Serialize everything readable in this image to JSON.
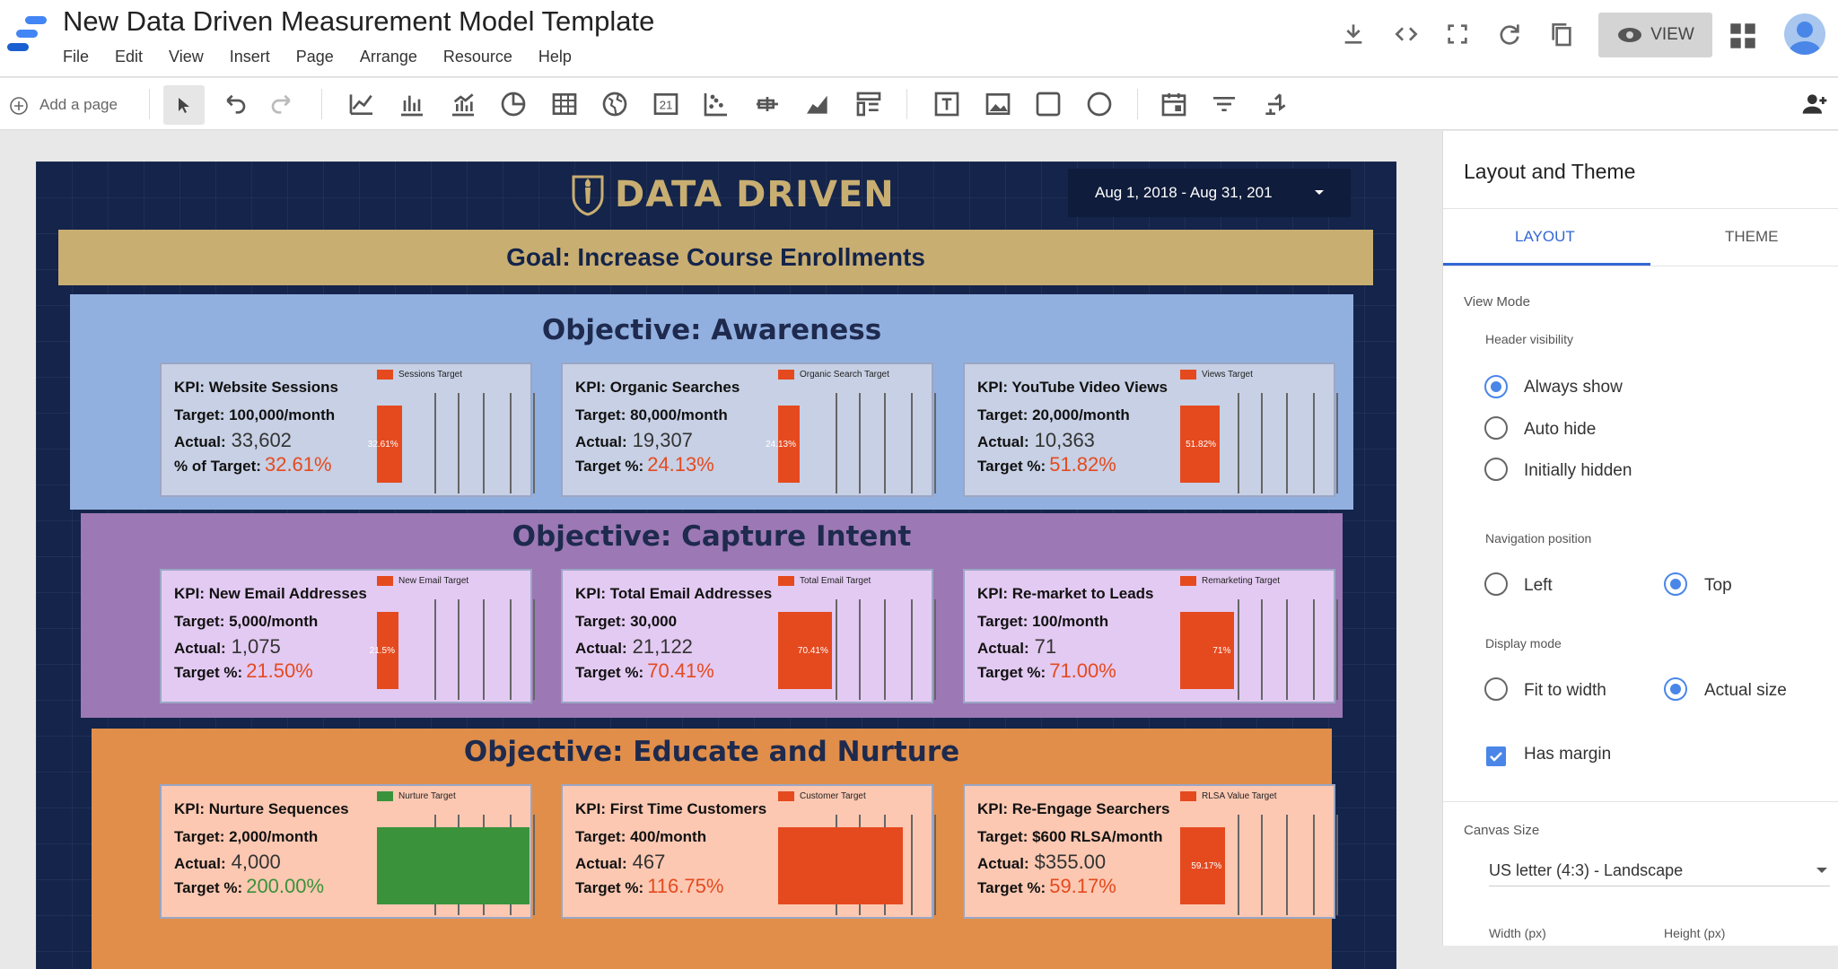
{
  "app": {
    "title": "New Data Driven Measurement Model Template"
  },
  "menu": [
    "File",
    "Edit",
    "View",
    "Insert",
    "Page",
    "Arrange",
    "Resource",
    "Help"
  ],
  "header": {
    "view_label": "VIEW"
  },
  "toolbar": {
    "add_page_label": "Add a page"
  },
  "report": {
    "logo_text": "DATA DRIVEN",
    "date_range": "Aug 1, 2018 - Aug 31, 201",
    "goal": "Goal: Increase Course Enrollments",
    "objectives": [
      {
        "title": "Objective: Awareness",
        "bg": "#92b0df",
        "kpis": [
          {
            "title": "KPI: Website Sessions",
            "target": "Target: 100,000/month",
            "actual_label": "Actual:",
            "actual": "33,602",
            "pct_label": "% of Target:",
            "pct": "32.61%",
            "pct_color": "#e54a1f",
            "legend": "Sessions Target",
            "bar_color": "#e54a1f",
            "bar_fraction": 0.3261,
            "bar_label": "32.61%"
          },
          {
            "title": "KPI: Organic Searches",
            "target": "Target: 80,000/month",
            "actual_label": "Actual:",
            "actual": "19,307",
            "pct_label": "Target %:",
            "pct": "24.13%",
            "pct_color": "#e54a1f",
            "legend": "Organic Search Target",
            "bar_color": "#e54a1f",
            "bar_fraction": 0.2413,
            "bar_label": "24.13%"
          },
          {
            "title": "KPI: YouTube Video Views",
            "target": "Target: 20,000/month",
            "actual_label": "Actual:",
            "actual": "10,363",
            "pct_label": "Target %:",
            "pct": "51.82%",
            "pct_color": "#e54a1f",
            "legend": "Views Target",
            "bar_color": "#e54a1f",
            "bar_fraction": 0.5182,
            "bar_label": "51.82%"
          }
        ]
      },
      {
        "title": "Objective: Capture Intent",
        "bg": "#9c78b4",
        "kpis": [
          {
            "title": "KPI: New Email Addresses",
            "target": "Target: 5,000/month",
            "actual_label": "Actual:",
            "actual": "1,075",
            "pct_label": "Target %:",
            "pct": "21.50%",
            "pct_color": "#e54a1f",
            "legend": "New Email Target",
            "bar_color": "#e54a1f",
            "bar_fraction": 0.215,
            "bar_label": "21.5%"
          },
          {
            "title": "KPI: Total Email Addresses",
            "target": "Target: 30,000",
            "actual_label": "Actual:",
            "actual": "21,122",
            "pct_label": "Target %:",
            "pct": "70.41%",
            "pct_color": "#e54a1f",
            "legend": "Total Email Target",
            "bar_color": "#e54a1f",
            "bar_fraction": 0.7041,
            "bar_label": "70.41%"
          },
          {
            "title": "KPI: Re-market to Leads",
            "target": "Target: 100/month",
            "actual_label": "Actual:",
            "actual": "71",
            "pct_label": "Target %:",
            "pct": "71.00%",
            "pct_color": "#e54a1f",
            "legend": "Remarketing Target",
            "bar_color": "#e54a1f",
            "bar_fraction": 0.71,
            "bar_label": "71%"
          }
        ]
      },
      {
        "title": "Objective: Educate and Nurture",
        "bg": "#e08e4a",
        "kpis": [
          {
            "title": "KPI: Nurture Sequences",
            "target": "Target: 2,000/month",
            "actual_label": "Actual:",
            "actual": "4,000",
            "pct_label": "Target %:",
            "pct": "200.00%",
            "pct_color": "#3a923a",
            "legend": "Nurture Target",
            "bar_color": "#3a923a",
            "bar_fraction": 2.0,
            "bar_label": ""
          },
          {
            "title": "KPI: First Time Customers",
            "target": "Target: 400/month",
            "actual_label": "Actual:",
            "actual": "467",
            "pct_label": "Target %:",
            "pct": "116.75%",
            "pct_color": "#e54a1f",
            "legend": "Customer Target",
            "bar_color": "#e54a1f",
            "bar_fraction": 1.1675,
            "bar_label": ""
          },
          {
            "title": "KPI: Re-Engage Searchers",
            "target": "Target: $600 RLSA/month",
            "actual_label": "Actual:",
            "actual": "$355.00",
            "pct_label": "Target %:",
            "pct": "59.17%",
            "pct_color": "#e54a1f",
            "legend": "RLSA Value Target",
            "bar_color": "#e54a1f",
            "bar_fraction": 0.5917,
            "bar_label": "59.17%"
          }
        ]
      }
    ]
  },
  "panel": {
    "title": "Layout and Theme",
    "tabs": [
      "LAYOUT",
      "THEME"
    ],
    "view_mode": "View Mode",
    "header_visibility": "Header visibility",
    "header_options": [
      "Always show",
      "Auto hide",
      "Initially hidden"
    ],
    "navigation_position": "Navigation position",
    "nav_options": [
      "Left",
      "Top"
    ],
    "display_mode": "Display mode",
    "display_options": [
      "Fit to width",
      "Actual size"
    ],
    "has_margin": "Has margin",
    "canvas_size": "Canvas Size",
    "canvas_value": "US letter (4:3) - Landscape",
    "width_label": "Width (px)",
    "height_label": "Height (px)"
  }
}
